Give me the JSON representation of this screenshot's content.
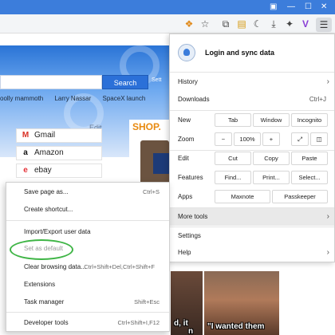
{
  "page": {
    "search_button": "Search",
    "settings_partial": "Sett",
    "trends": [
      "oolly mammoth",
      "Larry Nassar",
      "SpaceX launch"
    ],
    "edit_label": "Edit",
    "tiles": [
      {
        "label": "Gmail",
        "icon": "gmail-icon",
        "glyph": "M"
      },
      {
        "label": "Amazon",
        "icon": "amazon-icon",
        "glyph": "a"
      },
      {
        "label": "ebay",
        "icon": "ebay-icon",
        "glyph": "e"
      }
    ],
    "shop_label": "SHOP.",
    "caption_left": "d, it",
    "caption_left2": "n",
    "caption_right": "\"I wanted them"
  },
  "main_menu": {
    "login": "Login and sync data",
    "history": "History",
    "downloads": "Downloads",
    "downloads_shortcut": "Ctrl+J",
    "new_label": "New",
    "new_tab": "Tab",
    "new_window": "Window",
    "new_incognito": "Incognito",
    "zoom_label": "Zoom",
    "zoom_minus": "−",
    "zoom_value": "100%",
    "zoom_plus": "+",
    "edit_label": "Edit",
    "cut": "Cut",
    "copy": "Copy",
    "paste": "Paste",
    "features_label": "Features",
    "find": "Find...",
    "print": "Print...",
    "select": "Select...",
    "apps_label": "Apps",
    "maxnote": "Maxnote",
    "passkeeper": "Passkeeper",
    "more_tools": "More tools",
    "settings": "Settings",
    "help": "Help"
  },
  "sub_menu": {
    "items": [
      {
        "label": "Save page as...",
        "shortcut": "Ctrl+S"
      },
      {
        "label": "Create shortcut..."
      },
      {
        "label": "Import/Export user data"
      },
      {
        "label": "Set as default",
        "disabled": true
      },
      {
        "label": "Clear browsing data...",
        "shortcut": "Ctrl+Shift+Del,Ctrl+Shift+F"
      },
      {
        "label": "Extensions"
      },
      {
        "label": "Task manager",
        "shortcut": "Shift+Esc"
      },
      {
        "label": "Developer tools",
        "shortcut": "Ctrl+Shift+I,F12"
      }
    ]
  },
  "colors": {
    "titlebar": "#3c7ddb",
    "highlight_oval": "#3fb546"
  }
}
